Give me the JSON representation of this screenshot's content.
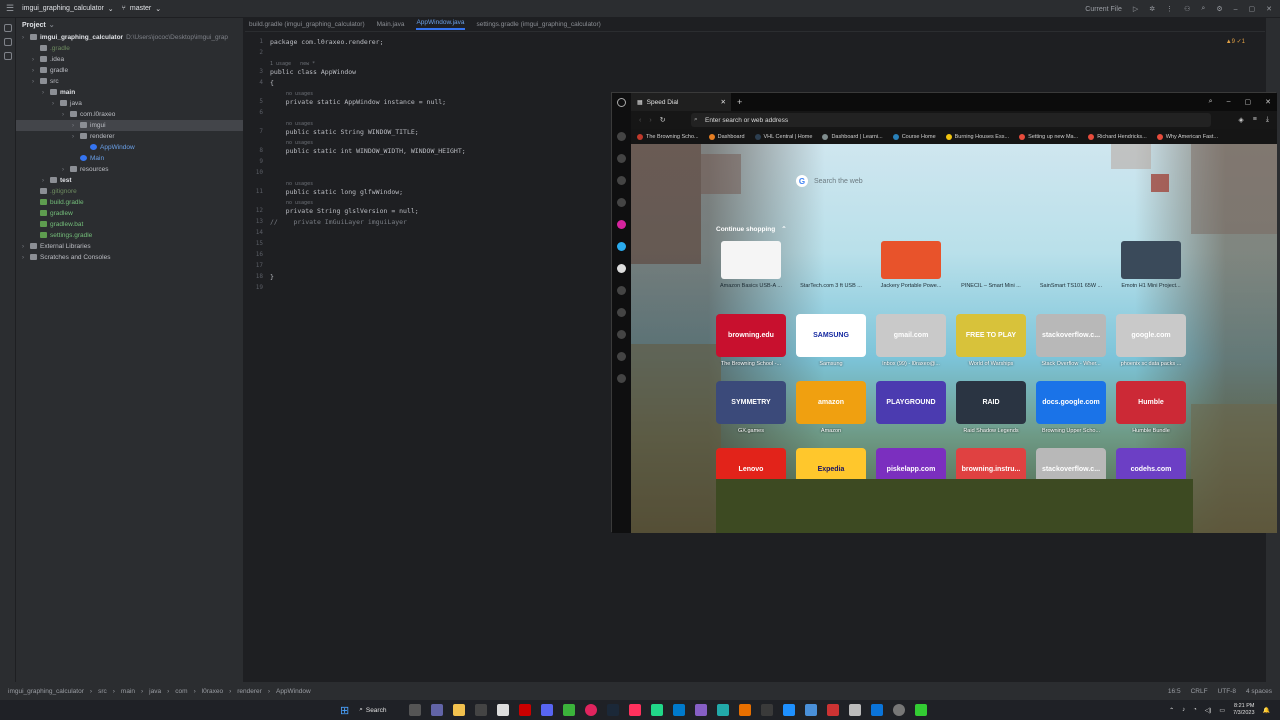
{
  "ide": {
    "project_name": "imgui_graphing_calculator",
    "branch": "master",
    "run_config": "Current File",
    "project_label": "Project",
    "tree": [
      {
        "label": "imgui_graphing_calculator",
        "extra": "D:\\Users\\jococ\\Desktop\\imgui_grap",
        "depth": 0,
        "bold": true
      },
      {
        "label": ".gradle",
        "depth": 1,
        "ignored": true
      },
      {
        "label": ".idea",
        "depth": 1
      },
      {
        "label": "gradle",
        "depth": 1
      },
      {
        "label": "src",
        "depth": 1
      },
      {
        "label": "main",
        "depth": 2,
        "bold": true
      },
      {
        "label": "java",
        "depth": 3
      },
      {
        "label": "com.l0raxeo",
        "depth": 4
      },
      {
        "label": "imgui",
        "depth": 5,
        "selected": true
      },
      {
        "label": "renderer",
        "depth": 5
      },
      {
        "label": "AppWindow",
        "depth": 6,
        "java": true
      },
      {
        "label": "Main",
        "depth": 5,
        "java": true
      },
      {
        "label": "resources",
        "depth": 4
      },
      {
        "label": "test",
        "depth": 2,
        "bold": true
      },
      {
        "label": ".gitignore",
        "depth": 1,
        "ignored": true
      },
      {
        "label": "build.gradle",
        "depth": 1,
        "green": true
      },
      {
        "label": "gradlew",
        "depth": 1,
        "green": true
      },
      {
        "label": "gradlew.bat",
        "depth": 1,
        "green": true
      },
      {
        "label": "settings.gradle",
        "depth": 1,
        "green": true
      },
      {
        "label": "External Libraries",
        "depth": 0
      },
      {
        "label": "Scratches and Consoles",
        "depth": 0
      }
    ],
    "tabs": [
      {
        "label": "build.gradle (imgui_graphing_calculator)"
      },
      {
        "label": "Main.java"
      },
      {
        "label": "AppWindow.java",
        "active": true
      },
      {
        "label": "settings.gradle (imgui_graphing_calculator)"
      }
    ],
    "code": [
      {
        "n": "1",
        "text": "package com.l0raxeo.renderer;"
      },
      {
        "n": "2",
        "text": ""
      },
      {
        "n": "3",
        "hint": "1 usage   new *",
        "text": "public class AppWindow"
      },
      {
        "n": "4",
        "text": "{"
      },
      {
        "n": "5",
        "hint": "no usages",
        "text": "    private static AppWindow instance = null;"
      },
      {
        "n": "6",
        "text": ""
      },
      {
        "n": "7",
        "hint": "no usages",
        "text": "    public static String WINDOW_TITLE;"
      },
      {
        "n": "8",
        "hint": "no usages",
        "text": "    public static int WINDOW_WIDTH, WINDOW_HEIGHT;"
      },
      {
        "n": "9",
        "text": ""
      },
      {
        "n": "10",
        "text": ""
      },
      {
        "n": "11",
        "hint": "no usages",
        "text": "    public static long glfwWindow;"
      },
      {
        "n": "12",
        "hint": "no usages",
        "text": "    private String glslVersion = null;"
      },
      {
        "n": "13",
        "text": "//    private ImGuiLayer imguiLayer"
      },
      {
        "n": "14",
        "text": ""
      },
      {
        "n": "15",
        "text": ""
      },
      {
        "n": "16",
        "text": ""
      },
      {
        "n": "17",
        "text": ""
      },
      {
        "n": "18",
        "text": "}"
      },
      {
        "n": "19",
        "text": ""
      }
    ],
    "warnings": "▲9  ✓1",
    "status_path": [
      "imgui_graphing_calculator",
      "src",
      "main",
      "java",
      "com",
      "l0raxeo",
      "renderer",
      "AppWindow"
    ],
    "status_right": [
      "16:5",
      "CRLF",
      "UTF-8",
      "4 spaces"
    ]
  },
  "browser": {
    "tab_title": "Speed Dial",
    "address_placeholder": "Enter search or web address",
    "bookmarks": [
      {
        "label": "The Browning Scho...",
        "color": "#c0392b"
      },
      {
        "label": "Dashboard",
        "color": "#e67e22"
      },
      {
        "label": "VHL Central | Home",
        "color": "#2c3e50"
      },
      {
        "label": "Dashboard | Learni...",
        "color": "#7f8c8d"
      },
      {
        "label": "Course Home",
        "color": "#2980b9"
      },
      {
        "label": "Burning Houses Ess...",
        "color": "#f1c40f"
      },
      {
        "label": "Setting up new Ma...",
        "color": "#e74c3c"
      },
      {
        "label": "Richard Hendricks...",
        "color": "#e74c3c"
      },
      {
        "label": "Why American Fast...",
        "color": "#e74c3c"
      }
    ],
    "search_placeholder": "Search the web",
    "continue_shopping": "Continue shopping",
    "products": [
      {
        "label": "Amazon Basics USB-A ...",
        "color": "#f5f5f5"
      },
      {
        "label": "StarTech.com 3 ft USB ...",
        "color": "transparent"
      },
      {
        "label": "Jackery Portable Powe...",
        "color": "#e8532b"
      },
      {
        "label": "PINECIL – Smart Mini ...",
        "color": "transparent"
      },
      {
        "label": "SainSmart TS101 65W ...",
        "color": "transparent"
      },
      {
        "label": "Emotn H1 Mini Project...",
        "color": "#3a4a5a"
      }
    ],
    "tiles": [
      {
        "text": "browning.edu",
        "label": "The Browning School -...",
        "bg": "#c8102e",
        "fg": "#ffffff"
      },
      {
        "text": "SAMSUNG",
        "label": "Samsung",
        "bg": "#ffffff",
        "fg": "#1428a0"
      },
      {
        "text": "gmail.com",
        "label": "Inbox (99) - l0raxeo@...",
        "bg": "#c9c9c9",
        "fg": "#ffffff"
      },
      {
        "text": "FREE TO PLAY",
        "label": "World of Warships",
        "bg": "#d8c23a",
        "fg": "#ffffff"
      },
      {
        "text": "stackoverflow.c...",
        "label": "Stack Overflow - Wher...",
        "bg": "#b8b8b8",
        "fg": "#ffffff"
      },
      {
        "text": "google.com",
        "label": "phoenix sc data packs ...",
        "bg": "#c9c9c9",
        "fg": "#ffffff"
      },
      {
        "text": "SYMMETRY",
        "label": "GX.games",
        "bg": "#3b4a7a",
        "fg": "#ffffff"
      },
      {
        "text": "amazon",
        "label": "Amazon",
        "bg": "#f0a010",
        "fg": "#ffffff"
      },
      {
        "text": "PLAYGROUND",
        "label": "",
        "bg": "#4b3bb0",
        "fg": "#ffffff"
      },
      {
        "text": "RAID",
        "label": "Raid Shadow Legends",
        "bg": "#2a3442",
        "fg": "#ffffff"
      },
      {
        "text": "docs.google.com",
        "label": "Browning Upper Scho...",
        "bg": "#1a73e8",
        "fg": "#ffffff"
      },
      {
        "text": "Humble",
        "label": "Humble Bundle",
        "bg": "#cc2936",
        "fg": "#ffffff"
      },
      {
        "text": "Lenovo",
        "label": "",
        "bg": "#e2231a",
        "fg": "#ffffff"
      },
      {
        "text": "Expedia",
        "label": "",
        "bg": "#ffc72c",
        "fg": "#1b1464"
      },
      {
        "text": "piskelapp.com",
        "label": "",
        "bg": "#7b2fbf",
        "fg": "#ffffff"
      },
      {
        "text": "browning.instru...",
        "label": "",
        "bg": "#e04141",
        "fg": "#ffffff"
      },
      {
        "text": "stackoverflow.c...",
        "label": "",
        "bg": "#b8b8b8",
        "fg": "#ffffff"
      },
      {
        "text": "codehs.com",
        "label": "",
        "bg": "#6c3fc5",
        "fg": "#ffffff"
      }
    ]
  },
  "taskbar": {
    "search_label": "Search",
    "time": "8:21 PM",
    "date": "7/3/2023"
  }
}
